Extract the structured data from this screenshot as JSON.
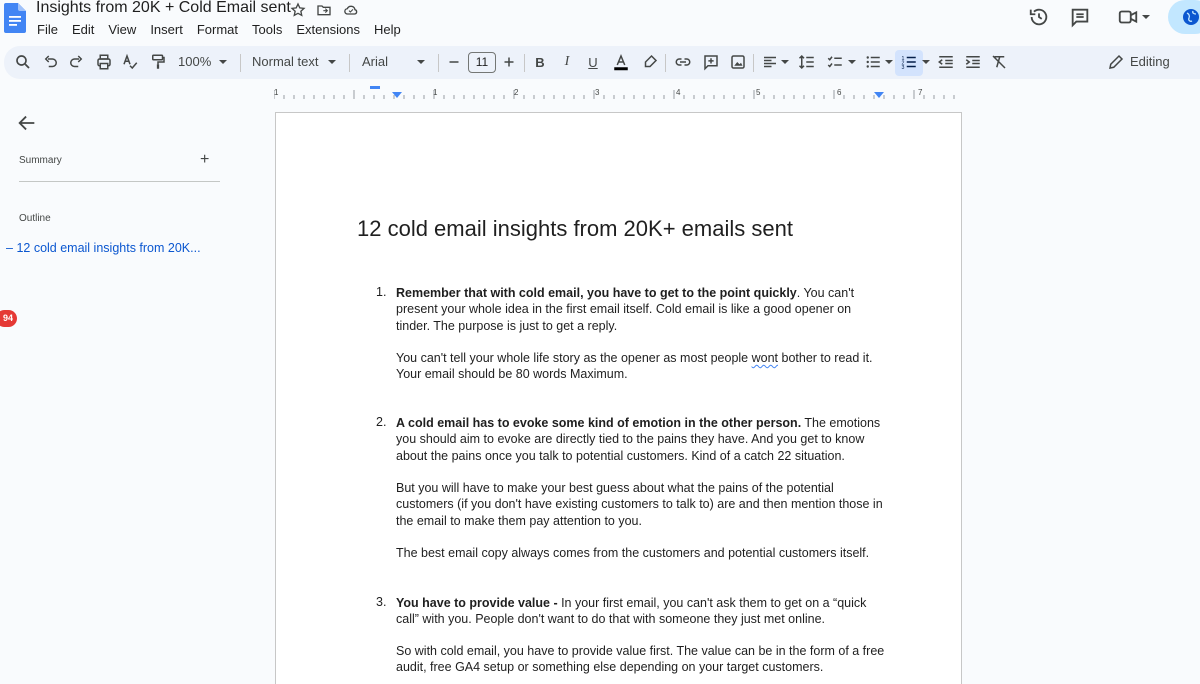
{
  "app": {
    "doc_title": "Insights from 20K + Cold Email sent",
    "menu": [
      "File",
      "Edit",
      "View",
      "Insert",
      "Format",
      "Tools",
      "Extensions",
      "Help"
    ]
  },
  "toolbar": {
    "zoom": "100%",
    "style": "Normal text",
    "font": "Arial",
    "font_size": "11",
    "mode": "Editing"
  },
  "ruler": {
    "numbers": [
      "1",
      "1",
      "2",
      "3",
      "4",
      "5",
      "6",
      "7"
    ]
  },
  "sidebar": {
    "summary_label": "Summary",
    "outline_label": "Outline",
    "outline_items": [
      "12 cold email insights from 20K..."
    ],
    "badge": "94"
  },
  "document": {
    "heading": "12 cold email insights from 20K+ emails sent",
    "items": [
      {
        "number": "1.",
        "bold": "Remember that with cold email, you have to get to the point quickly",
        "text": ". You can't present your whole idea in the first email itself. Cold email is like a good opener on tinder. The purpose is just to get a reply.",
        "extra_before": "You can't tell your whole life story as the opener as most people ",
        "extra_squiggle": "wont",
        "extra_after": " bother to read it. Your email should be 80 words Maximum."
      },
      {
        "number": "2.",
        "bold": "A cold email has to evoke some kind of emotion in the other person.",
        "text": " The emotions you should aim to evoke are directly tied to the pains they have. And you get to know about the pains once you talk to potential customers. Kind of a catch 22 situation.",
        "para2": "But you will have to make your best guess about what the pains of the potential customers (if you don't have existing customers to talk to) are and then mention those in the email to make them pay attention to you.",
        "para3": "The best email copy always comes from the customers and potential customers itself."
      },
      {
        "number": "3.",
        "bold": "You have to provide value -",
        "text": " In your first email, you can't ask them to get on a “quick call” with you. People don't want to do that with someone they just met online.",
        "para2": "So with cold email, you have to provide value first. The value can be in the form of a free audit, free GA4 setup or something else depending on your target customers."
      }
    ]
  }
}
